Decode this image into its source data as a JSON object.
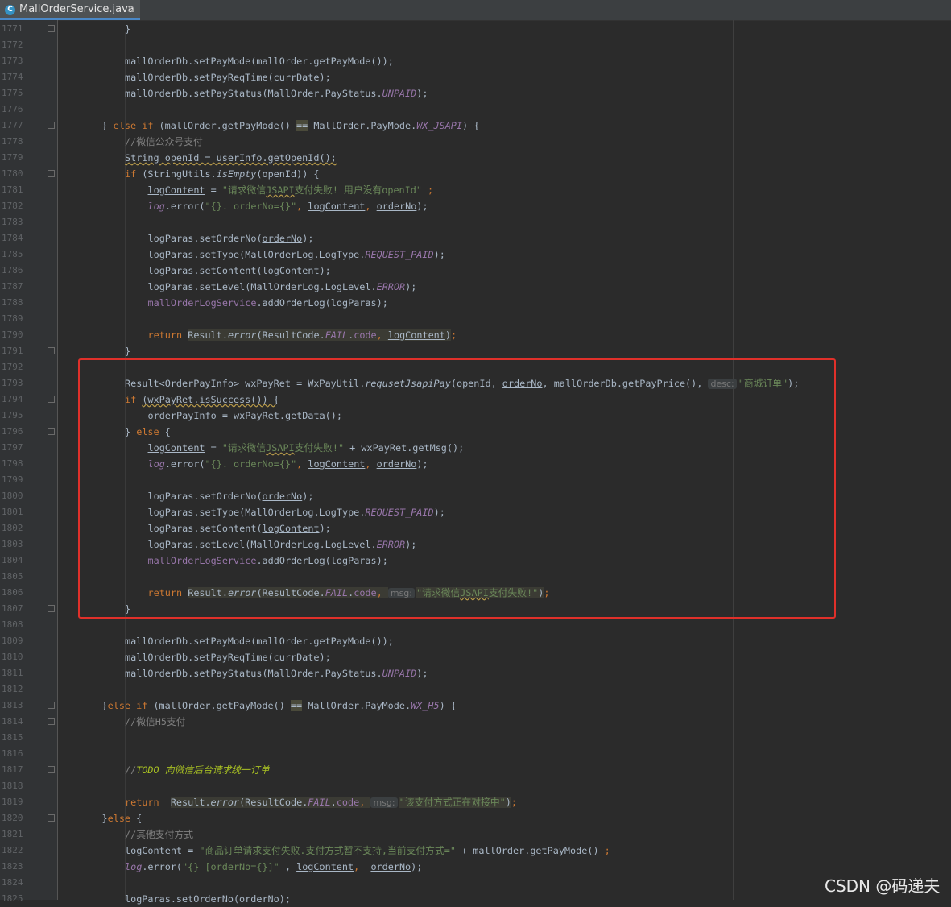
{
  "tab": {
    "label": "MallOrderService.java",
    "icon": "C",
    "close": "×"
  },
  "lines": [
    {
      "n": "1771",
      "fold": true,
      "i": 3,
      "tokens": [
        [
          "p",
          "}"
        ]
      ]
    },
    {
      "n": "1772",
      "i": 0,
      "tokens": []
    },
    {
      "n": "1773",
      "i": 3,
      "tokens": [
        [
          "p",
          "mallOrderDb.setPayMode(mallOrder.getPayMode());"
        ]
      ]
    },
    {
      "n": "1774",
      "i": 3,
      "tokens": [
        [
          "p",
          "mallOrderDb.setPayReqTime(currDate);"
        ]
      ]
    },
    {
      "n": "1775",
      "i": 3,
      "tokens": [
        [
          "p",
          "mallOrderDb.setPayStatus(MallOrder.PayStatus."
        ],
        [
          "co",
          "UNPAID"
        ],
        [
          "p",
          ");"
        ]
      ]
    },
    {
      "n": "1776",
      "i": 0,
      "tokens": []
    },
    {
      "n": "1777",
      "fold": true,
      "i": 2,
      "tokens": [
        [
          "p",
          "} "
        ],
        [
          "kw",
          "else if "
        ],
        [
          "p",
          "(mallOrder.getPayMode() "
        ],
        [
          "mrk",
          "=="
        ],
        [
          "p",
          " MallOrder.PayMode."
        ],
        [
          "co",
          "WX_JSAPI"
        ],
        [
          "p",
          ") {"
        ]
      ]
    },
    {
      "n": "1778",
      "i": 3,
      "tokens": [
        [
          "cm",
          "//微信公众号支付"
        ]
      ]
    },
    {
      "n": "1779",
      "i": 3,
      "tokens": [
        [
          "wavy",
          "String openId = userInfo.getOpenId();"
        ]
      ]
    },
    {
      "n": "1780",
      "fold": true,
      "i": 3,
      "tokens": [
        [
          "kw",
          "if "
        ],
        [
          "p",
          "(StringUtils."
        ],
        [
          "it",
          "isEmpty"
        ],
        [
          "p",
          "(openId)) {"
        ]
      ]
    },
    {
      "n": "1781",
      "i": 4,
      "tokens": [
        [
          "ul",
          "logContent"
        ],
        [
          "p",
          " = "
        ],
        [
          "st",
          "\"请求微信"
        ],
        [
          "stw",
          "JSAPI"
        ],
        [
          "st",
          "支付失败! 用户没有openId\""
        ],
        [
          "kw",
          " ;"
        ]
      ]
    },
    {
      "n": "1782",
      "i": 4,
      "tokens": [
        [
          "co",
          "log"
        ],
        [
          "p",
          ".error("
        ],
        [
          "st",
          "\"{}. orderNo={}\""
        ],
        [
          "kw",
          ", "
        ],
        [
          "ul",
          "logContent"
        ],
        [
          "kw",
          ", "
        ],
        [
          "ul",
          "orderNo"
        ],
        [
          "p",
          ");"
        ]
      ]
    },
    {
      "n": "1783",
      "i": 0,
      "tokens": []
    },
    {
      "n": "1784",
      "i": 4,
      "tokens": [
        [
          "p",
          "logParas.setOrderNo("
        ],
        [
          "ul",
          "orderNo"
        ],
        [
          "p",
          ");"
        ]
      ]
    },
    {
      "n": "1785",
      "i": 4,
      "tokens": [
        [
          "p",
          "logParas.setType(MallOrderLog.LogType."
        ],
        [
          "co",
          "REQUEST_PAID"
        ],
        [
          "p",
          ");"
        ]
      ]
    },
    {
      "n": "1786",
      "i": 4,
      "tokens": [
        [
          "p",
          "logParas.setContent("
        ],
        [
          "ul",
          "logContent"
        ],
        [
          "p",
          ");"
        ]
      ]
    },
    {
      "n": "1787",
      "i": 4,
      "tokens": [
        [
          "p",
          "logParas.setLevel(MallOrderLog.LogLevel."
        ],
        [
          "co",
          "ERROR"
        ],
        [
          "p",
          ");"
        ]
      ]
    },
    {
      "n": "1788",
      "i": 4,
      "tokens": [
        [
          "fld",
          "mallOrderLogService"
        ],
        [
          "p",
          ".addOrderLog(logParas);"
        ]
      ]
    },
    {
      "n": "1789",
      "i": 0,
      "tokens": []
    },
    {
      "n": "1790",
      "i": 4,
      "tokens": [
        [
          "kw",
          "return "
        ],
        [
          "hl",
          "Result."
        ],
        [
          "hli",
          "error"
        ],
        [
          "hl",
          "(ResultCode."
        ],
        [
          "hlco",
          "FAIL"
        ],
        [
          "hl",
          "."
        ],
        [
          "hlf",
          "code"
        ],
        [
          "hlk",
          ", "
        ],
        [
          "hlu",
          "logContent"
        ],
        [
          "hl",
          ")"
        ],
        [
          "kw",
          ";"
        ]
      ]
    },
    {
      "n": "1791",
      "fold": true,
      "i": 3,
      "tokens": [
        [
          "p",
          "}"
        ]
      ]
    },
    {
      "n": "1792",
      "i": 0,
      "tokens": []
    },
    {
      "n": "1793",
      "i": 3,
      "tokens": [
        [
          "p",
          "Result<OrderPayInfo> wxPayRet = WxPayUtil."
        ],
        [
          "it",
          "requsetJsapiPay"
        ],
        [
          "p",
          "(openId, "
        ],
        [
          "ul",
          "orderNo"
        ],
        [
          "p",
          ", mallOrderDb.getPayPrice(), "
        ],
        [
          "hint",
          "desc:"
        ],
        [
          "st",
          "\"商城订单\""
        ],
        [
          "p",
          ");"
        ]
      ]
    },
    {
      "n": "1794",
      "fold": true,
      "i": 3,
      "tokens": [
        [
          "kw",
          "if "
        ],
        [
          "wavy",
          "(wxPayRet.isSuccess()) {"
        ]
      ]
    },
    {
      "n": "1795",
      "i": 4,
      "tokens": [
        [
          "ul",
          "orderPayInfo"
        ],
        [
          "p",
          " = wxPayRet.getData();"
        ]
      ]
    },
    {
      "n": "1796",
      "fold": true,
      "i": 3,
      "tokens": [
        [
          "p",
          "} "
        ],
        [
          "kw",
          "else "
        ],
        [
          "p",
          "{"
        ]
      ]
    },
    {
      "n": "1797",
      "i": 4,
      "tokens": [
        [
          "ul",
          "logContent"
        ],
        [
          "p",
          " = "
        ],
        [
          "st",
          "\"请求微信"
        ],
        [
          "stw",
          "JSAPI"
        ],
        [
          "st",
          "支付失败!\""
        ],
        [
          "p",
          " + wxPayRet.getMsg();"
        ]
      ]
    },
    {
      "n": "1798",
      "i": 4,
      "tokens": [
        [
          "co",
          "log"
        ],
        [
          "p",
          ".error("
        ],
        [
          "st",
          "\"{}. orderNo={}\""
        ],
        [
          "kw",
          ", "
        ],
        [
          "ul",
          "logContent"
        ],
        [
          "kw",
          ", "
        ],
        [
          "ul",
          "orderNo"
        ],
        [
          "p",
          ");"
        ]
      ]
    },
    {
      "n": "1799",
      "i": 0,
      "tokens": []
    },
    {
      "n": "1800",
      "i": 4,
      "tokens": [
        [
          "p",
          "logParas.setOrderNo("
        ],
        [
          "ul",
          "orderNo"
        ],
        [
          "p",
          ");"
        ]
      ]
    },
    {
      "n": "1801",
      "i": 4,
      "tokens": [
        [
          "p",
          "logParas.setType(MallOrderLog.LogType."
        ],
        [
          "co",
          "REQUEST_PAID"
        ],
        [
          "p",
          ");"
        ]
      ]
    },
    {
      "n": "1802",
      "i": 4,
      "tokens": [
        [
          "p",
          "logParas.setContent("
        ],
        [
          "ul",
          "logContent"
        ],
        [
          "p",
          ");"
        ]
      ]
    },
    {
      "n": "1803",
      "i": 4,
      "tokens": [
        [
          "p",
          "logParas.setLevel(MallOrderLog.LogLevel."
        ],
        [
          "co",
          "ERROR"
        ],
        [
          "p",
          ");"
        ]
      ]
    },
    {
      "n": "1804",
      "i": 4,
      "tokens": [
        [
          "fld",
          "mallOrderLogService"
        ],
        [
          "p",
          ".addOrderLog(logParas);"
        ]
      ]
    },
    {
      "n": "1805",
      "i": 0,
      "tokens": []
    },
    {
      "n": "1806",
      "i": 4,
      "tokens": [
        [
          "kw",
          "return "
        ],
        [
          "hl",
          "Result."
        ],
        [
          "hli",
          "error"
        ],
        [
          "hl",
          "(ResultCode."
        ],
        [
          "hlco",
          "FAIL"
        ],
        [
          "hl",
          "."
        ],
        [
          "hlf",
          "code"
        ],
        [
          "hlk",
          ", "
        ],
        [
          "hint",
          "msg:"
        ],
        [
          "hls",
          "\"请求微信"
        ],
        [
          "hlsw",
          "JSAPI"
        ],
        [
          "hls",
          "支付失败!\""
        ],
        [
          "hl",
          ")"
        ],
        [
          "kw",
          ";"
        ]
      ]
    },
    {
      "n": "1807",
      "fold": true,
      "i": 3,
      "tokens": [
        [
          "p",
          "}"
        ]
      ]
    },
    {
      "n": "1808",
      "i": 0,
      "tokens": []
    },
    {
      "n": "1809",
      "i": 3,
      "tokens": [
        [
          "p",
          "mallOrderDb.setPayMode(mallOrder.getPayMode());"
        ]
      ]
    },
    {
      "n": "1810",
      "i": 3,
      "tokens": [
        [
          "p",
          "mallOrderDb.setPayReqTime(currDate);"
        ]
      ]
    },
    {
      "n": "1811",
      "i": 3,
      "tokens": [
        [
          "p",
          "mallOrderDb.setPayStatus(MallOrder.PayStatus."
        ],
        [
          "co",
          "UNPAID"
        ],
        [
          "p",
          ");"
        ]
      ]
    },
    {
      "n": "1812",
      "i": 0,
      "tokens": []
    },
    {
      "n": "1813",
      "fold": true,
      "i": 2,
      "tokens": [
        [
          "p",
          "}"
        ],
        [
          "kw",
          "else if "
        ],
        [
          "p",
          "(mallOrder.getPayMode() "
        ],
        [
          "mrk",
          "=="
        ],
        [
          "p",
          " MallOrder.PayMode."
        ],
        [
          "co",
          "WX_H5"
        ],
        [
          "p",
          ") {"
        ]
      ]
    },
    {
      "n": "1814",
      "fold": true,
      "i": 3,
      "tokens": [
        [
          "cm",
          "//微信H5支付"
        ]
      ]
    },
    {
      "n": "1815",
      "i": 0,
      "tokens": []
    },
    {
      "n": "1816",
      "i": 0,
      "tokens": []
    },
    {
      "n": "1817",
      "fold": true,
      "i": 3,
      "tokens": [
        [
          "cm",
          "//"
        ],
        [
          "todo",
          "TODO 向微信后台请求统一订单"
        ]
      ]
    },
    {
      "n": "1818",
      "i": 0,
      "tokens": []
    },
    {
      "n": "1819",
      "i": 3,
      "tokens": [
        [
          "kw",
          "return  "
        ],
        [
          "hl",
          "Result."
        ],
        [
          "hli",
          "error"
        ],
        [
          "hl",
          "(ResultCode."
        ],
        [
          "hlco",
          "FAIL"
        ],
        [
          "hl",
          "."
        ],
        [
          "hlf",
          "code"
        ],
        [
          "hlk",
          ", "
        ],
        [
          "hint",
          "msg:"
        ],
        [
          "hls",
          "\"该支付方式正在对接中\""
        ],
        [
          "hl",
          ")"
        ],
        [
          "kw",
          ";"
        ]
      ]
    },
    {
      "n": "1820",
      "fold": true,
      "i": 2,
      "tokens": [
        [
          "p",
          "}"
        ],
        [
          "kw",
          "else "
        ],
        [
          "p",
          "{"
        ]
      ]
    },
    {
      "n": "1821",
      "i": 3,
      "tokens": [
        [
          "cm",
          "//其他支付方式"
        ]
      ]
    },
    {
      "n": "1822",
      "i": 3,
      "tokens": [
        [
          "ul",
          "logContent"
        ],
        [
          "p",
          " = "
        ],
        [
          "st",
          "\"商品订单请求支付失败.支付方式暂不支持,当前支付方式=\""
        ],
        [
          "p",
          " + mallOrder.getPayMode() "
        ],
        [
          "kw",
          ";"
        ]
      ]
    },
    {
      "n": "1823",
      "i": 3,
      "tokens": [
        [
          "co",
          "log"
        ],
        [
          "p",
          ".error("
        ],
        [
          "st",
          "\"{} [orderNo={}]\""
        ],
        [
          "p",
          " , "
        ],
        [
          "ul",
          "logContent"
        ],
        [
          "kw",
          ",  "
        ],
        [
          "ul",
          "orderNo"
        ],
        [
          "p",
          ");"
        ]
      ]
    },
    {
      "n": "1824",
      "i": 0,
      "tokens": []
    },
    {
      "n": "1825",
      "i": 3,
      "tokens": [
        [
          "p",
          "logParas.setOrderNo(orderNo);"
        ]
      ]
    }
  ],
  "watermark": "CSDN @码递夫"
}
